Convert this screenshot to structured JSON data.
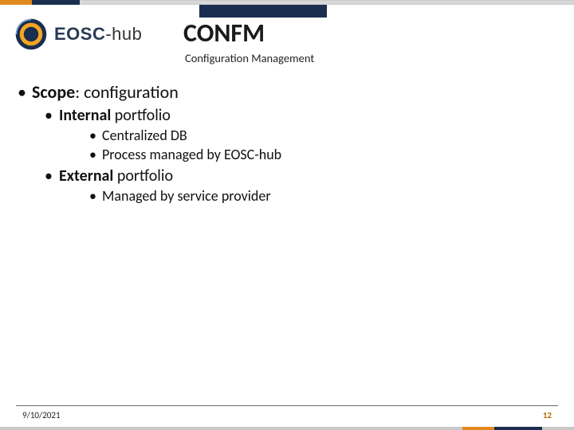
{
  "logo": {
    "brand": "EOSC",
    "suffix": "-hub"
  },
  "title": "CONFM",
  "subtitle": "Configuration Management",
  "content": {
    "scope_label": "Scope",
    "scope_value": "configuration",
    "internal_label_bold": "Internal",
    "internal_label_rest": "portfolio",
    "internal_items": [
      "Centralized DB",
      "Process managed by EOSC-hub"
    ],
    "external_label_bold": "External",
    "external_label_rest": "portfolio",
    "external_items": [
      "Managed by service provider"
    ]
  },
  "footer": {
    "date": "9/10/2021",
    "page": "12"
  }
}
